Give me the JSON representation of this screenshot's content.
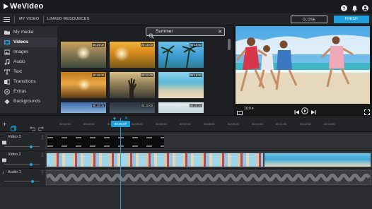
{
  "app": {
    "logo_text": "WeVideo"
  },
  "header": {
    "tabs": [
      {
        "label": "MY VIDEO"
      },
      {
        "label": "LINKED RESOURCES"
      }
    ],
    "close_label": "CLOSE",
    "finish_label": "FINISH",
    "accent_color": "#1fa0dc",
    "icons": [
      "help-icon",
      "notifications-icon",
      "account-icon"
    ]
  },
  "sidebar": {
    "items": [
      {
        "label": "My media",
        "icon": "folder-icon"
      },
      {
        "label": "Videos",
        "icon": "film-icon",
        "active": true
      },
      {
        "label": "Images",
        "icon": "image-icon"
      },
      {
        "label": "Audio",
        "icon": "music-note-icon"
      },
      {
        "label": "Text",
        "icon": "text-icon"
      },
      {
        "label": "Transitions",
        "icon": "transitions-icon"
      },
      {
        "label": "Extras",
        "icon": "extras-icon"
      },
      {
        "label": "Backgrounds",
        "icon": "backgrounds-icon"
      }
    ]
  },
  "search": {
    "value": "Summer"
  },
  "media": {
    "thumbnails": [
      {
        "duration": "00:24:00"
      },
      {
        "duration": "00:16:00"
      },
      {
        "duration": "00:15:00"
      },
      {
        "duration": "00:16:00"
      },
      {
        "duration": "00:21:00"
      },
      {
        "duration": "00:16:00"
      },
      {
        "duration": "00:10:00"
      },
      {
        "duration": "00:22:00"
      },
      {
        "duration": "00:20:00"
      }
    ]
  },
  "preview": {
    "aspect_label": "16:9"
  },
  "timeline": {
    "playhead_time": "00:04:07",
    "ticks": [
      "00:02:00",
      "00:03:00",
      "00:04:00",
      "00:05:00",
      "00:06:00",
      "00:07:00",
      "00:08:00",
      "00:09:00",
      "00:10:00",
      "00:11:00",
      "00:12:00",
      "00:13:00"
    ],
    "tracks": [
      {
        "name": "Video 3"
      },
      {
        "name": "Video 2"
      },
      {
        "name": "Audio 1"
      }
    ],
    "track_volume_levels": [
      0.75,
      0.75,
      0.8
    ]
  }
}
